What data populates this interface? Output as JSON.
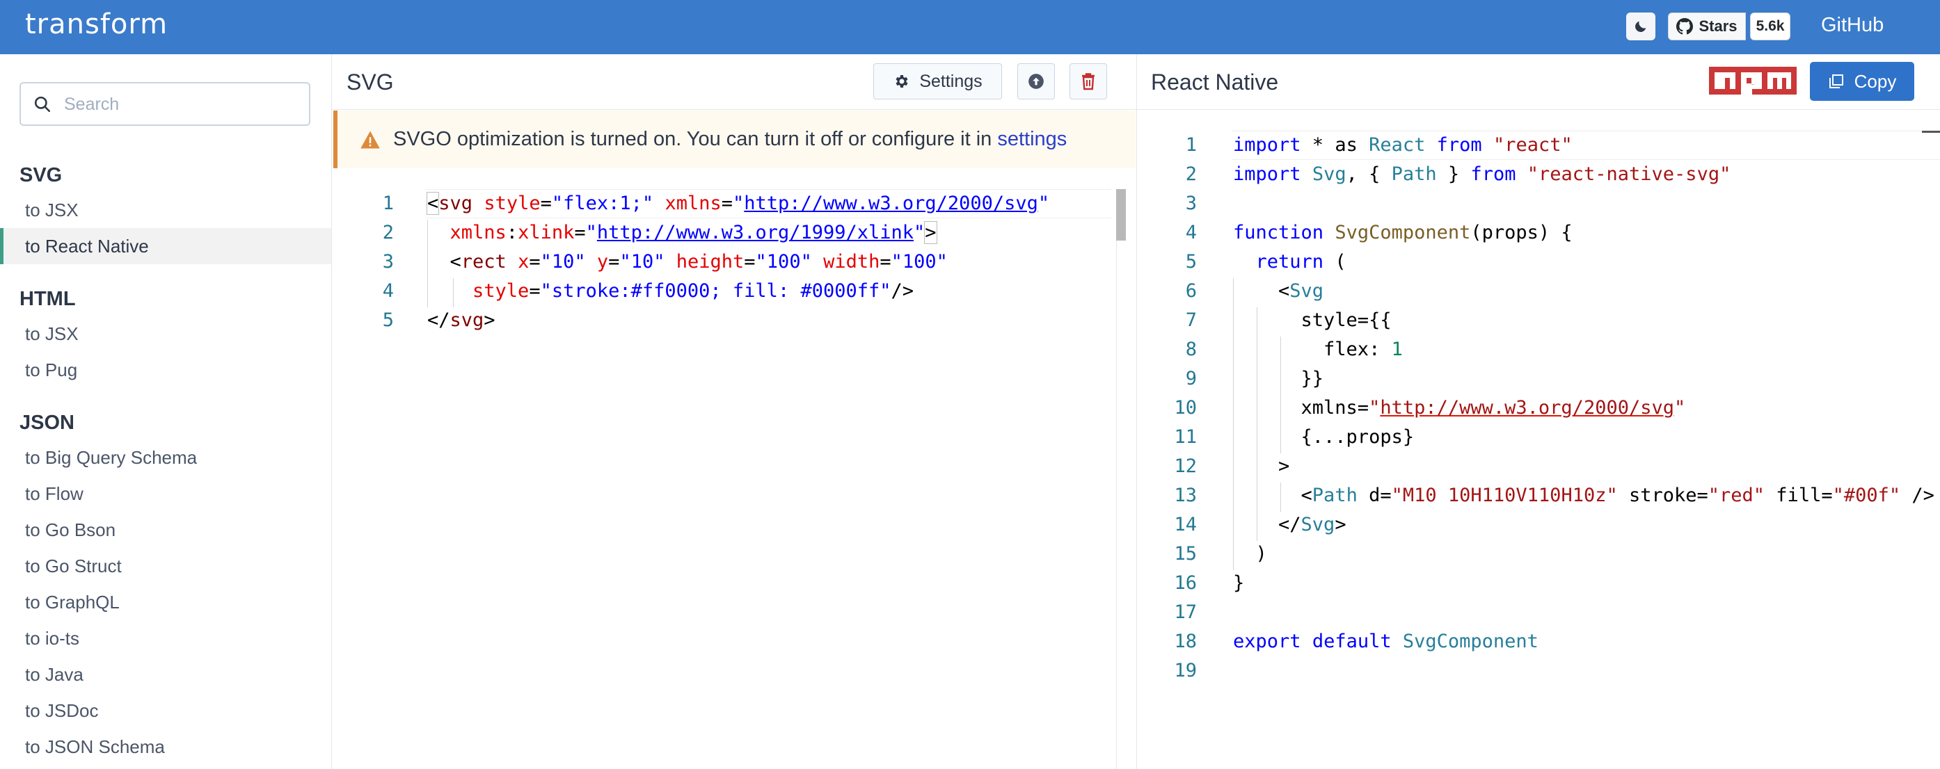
{
  "header": {
    "brand": "transform",
    "github_stars_label": "Stars",
    "github_stars_count": "5.6k",
    "github_link": "GitHub"
  },
  "sidebar": {
    "search_placeholder": "Search",
    "sections": [
      {
        "title": "SVG",
        "items": [
          "to JSX",
          "to React Native"
        ]
      },
      {
        "title": "HTML",
        "items": [
          "to JSX",
          "to Pug"
        ]
      },
      {
        "title": "JSON",
        "items": [
          "to Big Query Schema",
          "to Flow",
          "to Go Bson",
          "to Go Struct",
          "to GraphQL",
          "to io-ts",
          "to Java",
          "to JSDoc",
          "to JSON Schema"
        ]
      }
    ],
    "active_item": "to React Native"
  },
  "left_panel": {
    "title": "SVG",
    "settings_label": "Settings",
    "banner_text": "SVGO optimization is turned on. You can turn it off or configure it in",
    "banner_link": "settings",
    "line_numbers": [
      "1",
      "2",
      "3",
      "4",
      "5"
    ]
  },
  "right_panel": {
    "title": "React Native",
    "copy_label": "Copy",
    "npm_logo": "npm",
    "line_numbers": [
      "1",
      "2",
      "3",
      "4",
      "5",
      "6",
      "7",
      "8",
      "9",
      "10",
      "11",
      "12",
      "13",
      "14",
      "15",
      "16",
      "17",
      "18",
      "19"
    ]
  },
  "colors": {
    "header_bg": "#3a7bcb",
    "active_accent": "#3f9e86",
    "warning": "#dd8a3a",
    "copy_button": "#2f72c9",
    "npm_red": "#cb3837"
  }
}
